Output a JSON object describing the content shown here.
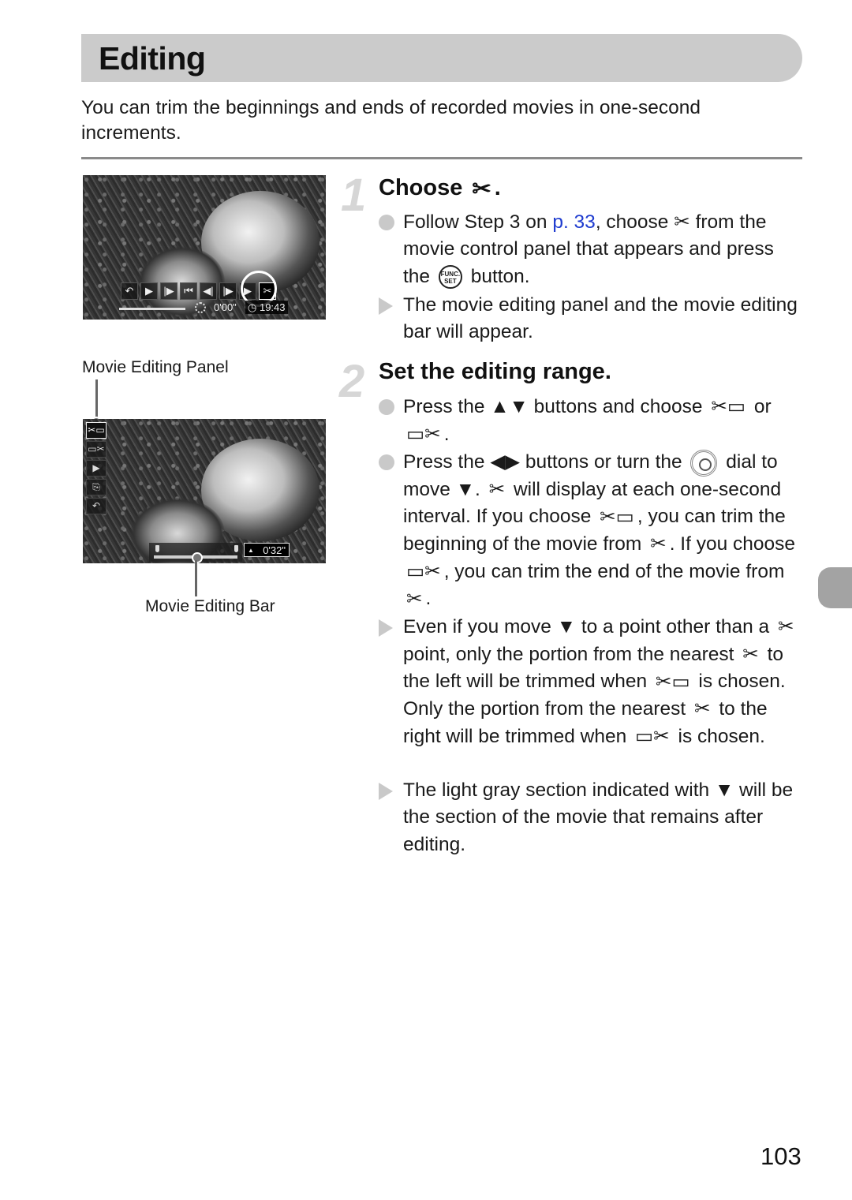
{
  "header": {
    "title": "Editing",
    "intro": "You can trim the beginnings and ends of recorded movies in one-second increments."
  },
  "screen1": {
    "controls": [
      "undo-icon",
      "play-icon",
      "slow-play-icon",
      "skip-start-icon",
      "frame-back-icon",
      "frame-forward-icon",
      "skip-end-icon",
      "scissors-icon"
    ],
    "time": "0'00\"",
    "clock": "19:43"
  },
  "screen2": {
    "panel_buttons": [
      "trim-start-icon",
      "trim-end-icon",
      "play-icon",
      "save-icon",
      "undo-icon"
    ],
    "time": "0'32\"",
    "label_panel": "Movie Editing Panel",
    "label_bar": "Movie Editing Bar"
  },
  "step1": {
    "number": "1",
    "heading": "Choose",
    "heading_end": ".",
    "b1_a": "Follow Step 3 on ",
    "b1_link": "p. 33",
    "b1_b": ", choose",
    "b1_c": "from the movie control panel that appears and press the",
    "b1_d": "button.",
    "func_label_1": "FUNC.",
    "func_label_2": "SET",
    "r1": "The movie editing panel and the movie editing bar will appear."
  },
  "step2": {
    "number": "2",
    "heading": "Set the editing range.",
    "b1_a": "Press the",
    "b1_b": "buttons and choose",
    "b1_c": "or",
    "b1_d": ".",
    "b2_a": "Press the",
    "b2_b": "buttons or turn the",
    "b2_c": "dial to move",
    "b2_d": ".",
    "b2_e": "will display at each one-second interval. If you choose",
    "b2_f": ", you can trim the beginning of the movie from",
    "b2_g": ". If you choose",
    "b2_h": ", you can trim the end of the movie from",
    "b2_i": ".",
    "r1_a": "Even if you move",
    "r1_b": "to a point other than a",
    "r1_c": "point, only the portion from the nearest",
    "r1_d": "to the left will be trimmed when",
    "r1_e": "is chosen. Only the portion from the nearest",
    "r1_f": "to the right will be trimmed when",
    "r1_g": "is chosen.",
    "r2_a": "The light gray section indicated with",
    "r2_b": "will be the section of the movie that remains after editing."
  },
  "colors": {
    "title_bar": "#cbcbcb",
    "link": "#1f3ccf",
    "step_number": "#d6d6d6",
    "side_tab": "#a3a3a3"
  },
  "footer": {
    "page_number": "103"
  }
}
